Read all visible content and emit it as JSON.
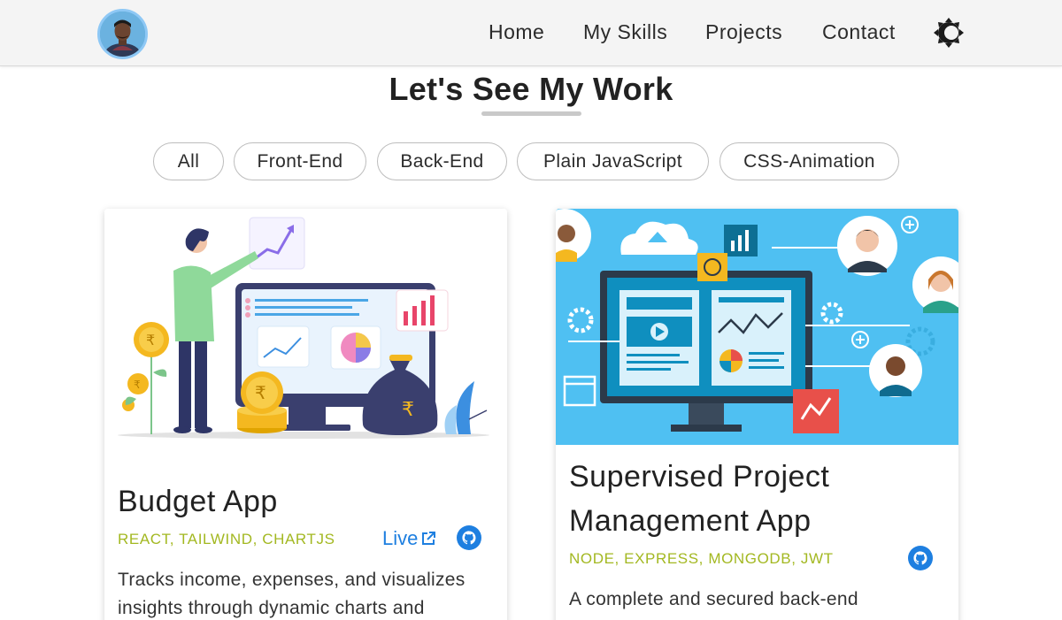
{
  "nav": {
    "avatar": "profile-photo",
    "links": [
      "Home",
      "My Skills",
      "Projects",
      "Contact"
    ],
    "theme_icon": "theme-toggle-icon"
  },
  "section": {
    "title": "Let's See My Work"
  },
  "filters": [
    "All",
    "Front-End",
    "Back-End",
    "Plain JavaScript",
    "CSS-Animation"
  ],
  "projects": [
    {
      "title": "Budget App",
      "tags": "REACT, TAILWIND, CHARTJS",
      "live_label": "Live",
      "description": "Tracks income, expenses, and visualizes insights through dynamic charts and",
      "image": "budget-illustration"
    },
    {
      "title_line1": "Supervised Project",
      "title_line2": "Management App",
      "tags": "NODE, EXPRESS, MONGODB, JWT",
      "description": "A complete and secured back-end",
      "image": "project-management-illustration"
    }
  ],
  "colors": {
    "tag": "#a3b821",
    "link": "#1e7fe0",
    "github": "#1e7fe0",
    "navbar_bg": "#f4f4f4"
  }
}
